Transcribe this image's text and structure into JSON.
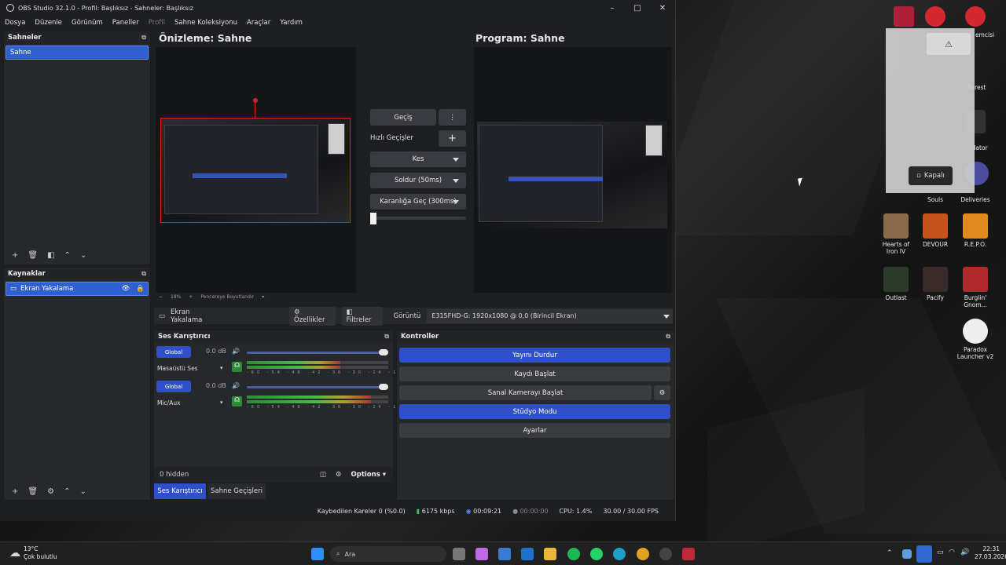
{
  "window": {
    "title": "OBS Studio 32.1.0 - Profil: Başlıksız - Sahneler: Başlıksız"
  },
  "menu": [
    "Dosya",
    "Düzenle",
    "Görünüm",
    "Paneller",
    "Profil",
    "Sahne Koleksiyonu",
    "Araçlar",
    "Yardım"
  ],
  "scenes": {
    "title": "Sahneler",
    "items": [
      "Sahne"
    ]
  },
  "sources": {
    "title": "Kaynaklar",
    "items": [
      "Ekran Yakalama"
    ]
  },
  "preview": {
    "title": "Önizleme: Sahne",
    "zoom": "18%",
    "fit": "Pencereye Boyutlandır"
  },
  "program": {
    "title": "Program: Sahne"
  },
  "transitions": {
    "transition_btn": "Geçiş",
    "quick_label": "Hızlı Geçişler",
    "items": [
      "Kes",
      "Soldur (50ms)",
      "Karanlığa Geç (300ms)"
    ]
  },
  "sourcebar": {
    "source": "Ekran Yakalama",
    "props": "Özellikler",
    "filters": "Filtreler",
    "display_label": "Görüntü",
    "display_value": "E315FHD-G: 1920x1080 @ 0,0 (Birincil Ekran)"
  },
  "mixer": {
    "title": "Ses Karıştırıcı",
    "channels": [
      {
        "badge": "Global",
        "db": "0.0 dB",
        "name": "Masaüstü Ses",
        "level": 0.66
      },
      {
        "badge": "Global",
        "db": "0.0 dB",
        "name": "Mic/Aux",
        "level": 0.88
      }
    ],
    "ticks": "-60 -54 -48 -42 -36 -30 -24 -18 -12 -6 0",
    "hidden": "0 hidden",
    "options": "Options"
  },
  "controls": {
    "title": "Kontroller",
    "stop_stream": "Yayını Durdur",
    "start_record": "Kaydı Başlat",
    "virtual_cam": "Sanal Kamerayı Başlat",
    "studio": "Stüdyo Modu",
    "settings": "Ayarlar"
  },
  "tabs": {
    "mixer": "Ses Karıştırıcı",
    "transitions": "Sahne Geçişleri"
  },
  "status": {
    "dropped": "Kaybedilen Kareler 0 (%0.0)",
    "bitrate": "6175 kbps",
    "stream_time": "00:09:21",
    "record_time": "00:00:00",
    "cpu": "CPU: 1.4%",
    "fps": "30.00 / 30.00 FPS"
  },
  "desktop": {
    "icons": [
      {
        "label": "Hearts of Iron IV",
        "color": "#8a6a4a"
      },
      {
        "label": "DEVOUR",
        "color": "#c4541c"
      },
      {
        "label": "R.E.P.O.",
        "color": "#e08a1c"
      },
      {
        "label": "Outlast",
        "color": "#2c3a2c"
      },
      {
        "label": "Pacify",
        "color": "#3a2a2a"
      },
      {
        "label": "Burglin' Gnom...",
        "color": "#b02a2a"
      },
      {
        "label": "Paradox Launcher v2",
        "color": "#eeeeee"
      }
    ],
    "partial": [
      "Souls",
      "Deliveries",
      "Forest",
      "emcisi",
      "lator"
    ],
    "notif_btn": "Kapalı"
  },
  "taskbar": {
    "weather_temp": "13°C",
    "weather_desc": "Çok bulutlu",
    "search": "Ara",
    "time": "22:31",
    "date": "27.03.2026"
  }
}
